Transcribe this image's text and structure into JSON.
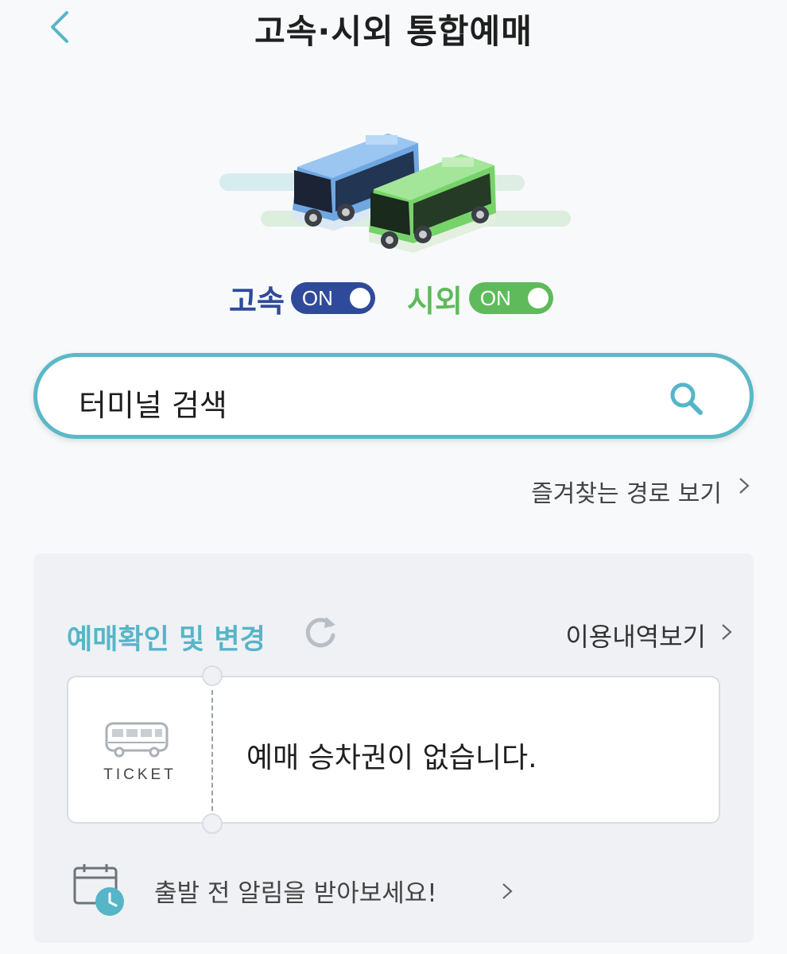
{
  "header": {
    "title": "고속·시외 통합예매"
  },
  "toggles": {
    "express": {
      "label": "고속",
      "state": "ON",
      "color": "#2f4a9a"
    },
    "intercity": {
      "label": "시외",
      "state": "ON",
      "color": "#5eba5a"
    }
  },
  "search": {
    "placeholder": "터미널 검색"
  },
  "favorites": {
    "label": "즐겨찾는 경로 보기"
  },
  "reservation": {
    "title": "예매확인 및 변경",
    "history_label": "이용내역보기",
    "ticket": {
      "caption": "TICKET",
      "empty_message": "예매 승차권이 없습니다."
    },
    "alarm_label": "출발 전 알림을 받아보세요!"
  },
  "colors": {
    "accent": "#56b5c8",
    "express_blue": "#2f4a9a",
    "intercity_green": "#5eba5a"
  }
}
